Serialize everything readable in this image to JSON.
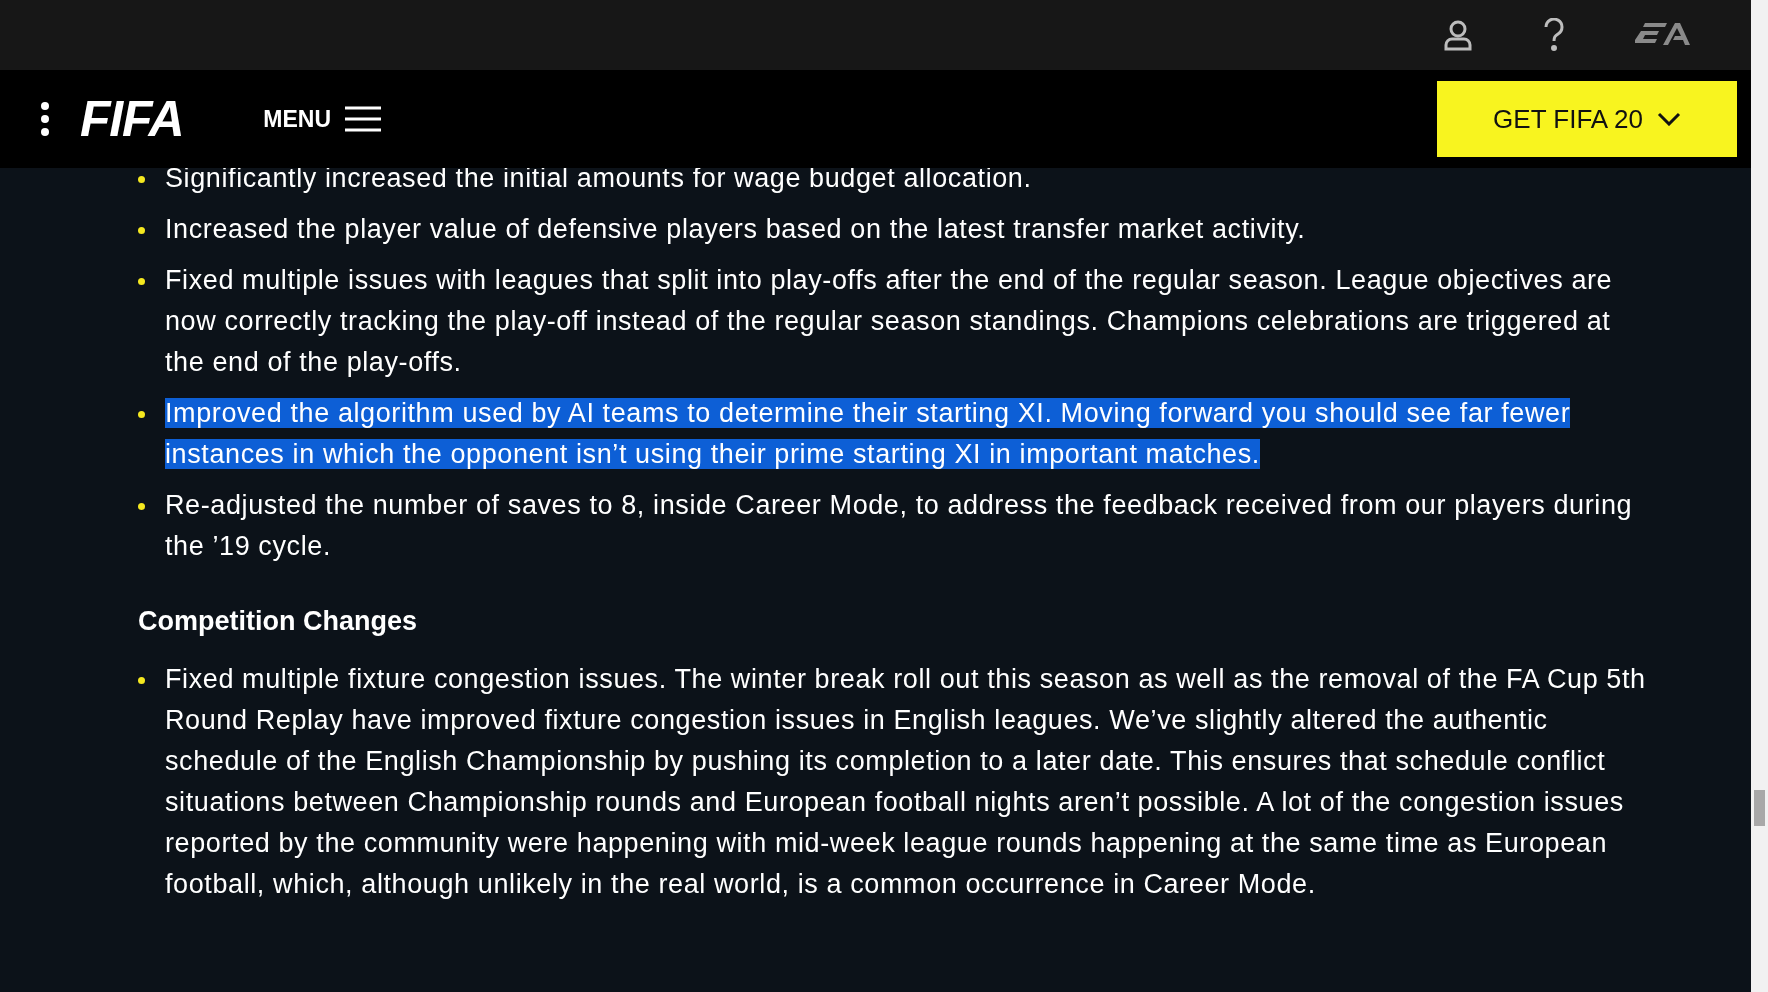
{
  "header": {
    "logo": "FIFA",
    "menu_label": "MENU",
    "cta": "GET FIFA 20"
  },
  "sections": [
    {
      "items": [
        {
          "text": "Significantly increased the initial amounts for wage budget allocation.",
          "highlighted": false
        },
        {
          "text": "Increased the player value of defensive players based on the latest transfer market activity.",
          "highlighted": false
        },
        {
          "text": "Fixed multiple issues with leagues that split into play-offs after the end of the regular season. League objectives are now correctly tracking the play-off instead of the regular season standings. Champions celebrations are triggered at the end of the play-offs.",
          "highlighted": false
        },
        {
          "text": "Improved the algorithm used by AI teams to determine their starting XI. Moving forward you should see far fewer instances in which the opponent isn’t using their prime starting XI in important matches.",
          "highlighted": true
        },
        {
          "text": "Re-adjusted the number of saves to 8, inside Career Mode, to address the feedback received from our players during the ’19 cycle.",
          "highlighted": false
        }
      ]
    },
    {
      "heading": "Competition Changes",
      "items": [
        {
          "text": "Fixed multiple fixture congestion issues. The winter break roll out this season as well as the removal of the FA Cup 5th Round Replay have improved fixture congestion issues in English leagues. We’ve slightly altered the authentic schedule of the English Championship by pushing its completion to a later date. This ensures that schedule conflict situations between Championship rounds and European football nights aren’t possible. A lot of the congestion issues reported by the community were happening with mid-week league rounds happening at the same time as European football, which, although unlikely in the real world, is a common occurrence in Career Mode.",
          "highlighted": false
        }
      ]
    }
  ]
}
